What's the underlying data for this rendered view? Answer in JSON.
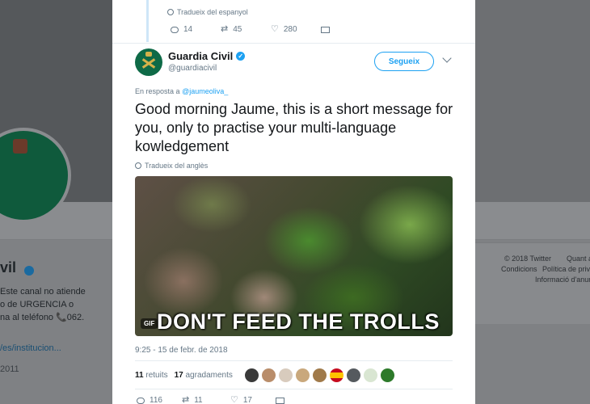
{
  "background_profile": {
    "name_fragment": "vil",
    "bio_lines": [
      "Este canal no atiende",
      "o de URGENCIA o",
      "na al teléfono 📞062."
    ],
    "website": "/es/institucion...",
    "joined_year": "2011",
    "footer": {
      "copyright": "© 2018 Twitter",
      "about": "Quant a",
      "conditions": "Condicions",
      "privacy": "Política de priva",
      "ads_info": "Informació d'anur"
    }
  },
  "previous_tweet": {
    "translate_label": "Tradueix del espanyol",
    "replies": "14",
    "retweets": "45",
    "likes": "280"
  },
  "tweet": {
    "display_name": "Guardia Civil",
    "handle": "@guardiacivil",
    "follow_label": "Segueix",
    "reply_to_prefix": "En resposta a",
    "reply_to_handle": "@jaumeoliva_",
    "text": "Good morning Jaume, this is a short message for you, only to practise your multi-language kowledgement",
    "translate_label": "Tradueix del anglès",
    "media": {
      "badge": "GIF",
      "caption": "DON'T FEED THE TROLLS"
    },
    "timestamp": "9:25 - 15 de febr. de 2018",
    "retweets_count": "11",
    "retweets_label": "retuits",
    "likes_count": "17",
    "likes_label": "agradaments",
    "footer_actions": {
      "replies": "116",
      "retweets": "11",
      "likes": "17"
    }
  },
  "colors": {
    "accent": "#1da1f2",
    "text": "#14171a",
    "muted": "#657786",
    "overlay": "#7f8184"
  }
}
